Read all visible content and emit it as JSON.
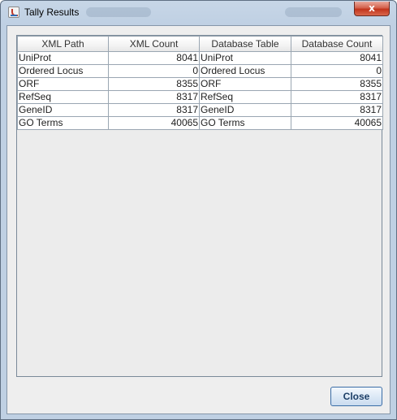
{
  "window": {
    "title": "Tally Results",
    "close_glyph": "x",
    "icon": "java-cup-icon"
  },
  "table": {
    "columns": [
      "XML Path",
      "XML Count",
      "Database Table",
      "Database Count"
    ],
    "rows": [
      [
        "UniProt",
        "8041",
        "UniProt",
        "8041"
      ],
      [
        "Ordered Locus",
        "0",
        "Ordered Locus",
        "0"
      ],
      [
        "ORF",
        "8355",
        "ORF",
        "8355"
      ],
      [
        "RefSeq",
        "8317",
        "RefSeq",
        "8317"
      ],
      [
        "GeneID",
        "8317",
        "GeneID",
        "8317"
      ],
      [
        "GO Terms",
        "40065",
        "GO Terms",
        "40065"
      ]
    ]
  },
  "buttons": {
    "close_label": "Close"
  }
}
